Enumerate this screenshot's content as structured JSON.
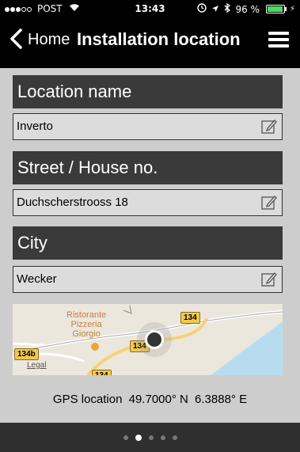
{
  "status_bar": {
    "carrier": "POST",
    "signal_bars_filled": 3,
    "signal_bars_total": 5,
    "time": "13:43",
    "battery_percent": "96 %",
    "battery_level": 0.96
  },
  "nav": {
    "back_label": "Home",
    "title": "Installation location"
  },
  "form": {
    "location_name": {
      "label": "Location name",
      "value": "Inverto"
    },
    "street": {
      "label": "Street / House no.",
      "value": "Duchscherstrooss 18"
    },
    "city": {
      "label": "City",
      "value": "Wecker"
    }
  },
  "map": {
    "poi_line1": "Ristorante",
    "poi_line2": "Pizzeria",
    "poi_line3": "Giorgio",
    "road_134": "134",
    "road_134b": "134b",
    "road_134_bottom": "134",
    "legal": "Legal"
  },
  "gps": {
    "label": "GPS location",
    "lat": "49.7000° N",
    "lon": "6.3888° E"
  },
  "pager": {
    "total": 5,
    "active_index": 1
  },
  "colors": {
    "header_bg": "#3a3a3a",
    "content_bg": "#cdcdcd",
    "battery": "#4cd964",
    "road_shield": "#f2c94c"
  }
}
